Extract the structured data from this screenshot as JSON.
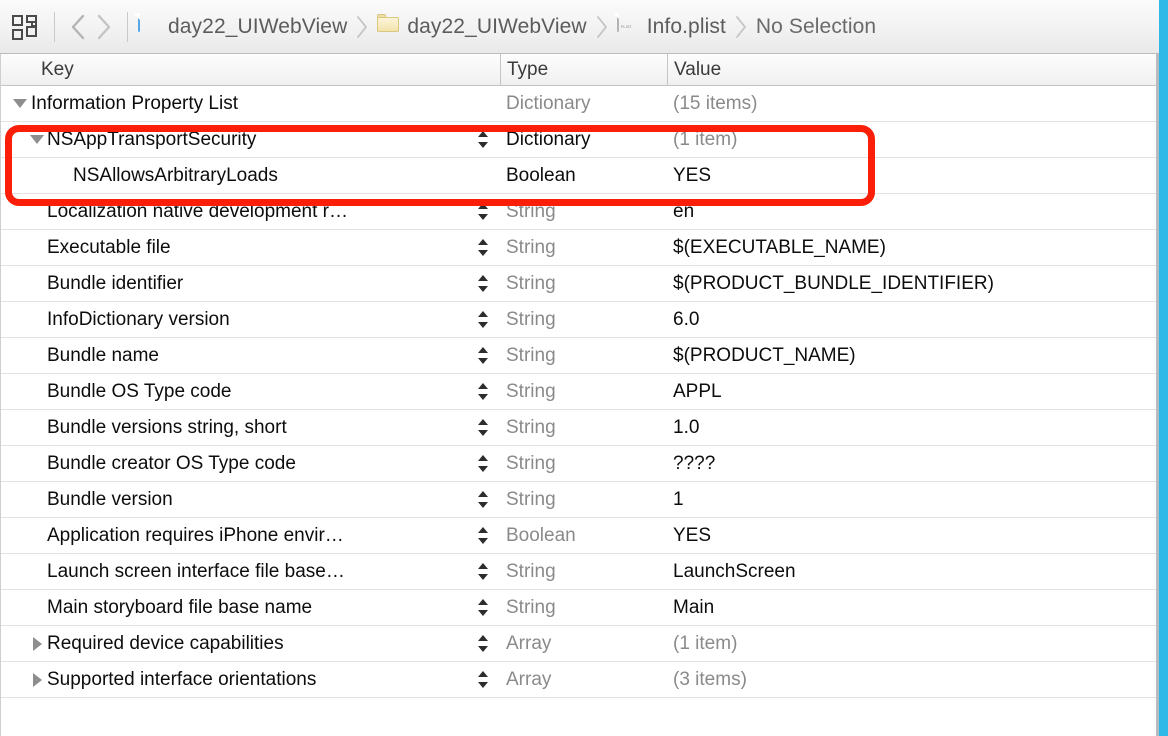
{
  "jumpbar": {
    "grid_icon": "grid-icon",
    "back_label": "Back",
    "forward_label": "Forward",
    "breadcrumbs": [
      {
        "label": "day22_UIWebView",
        "icon": "xcodeproj-icon"
      },
      {
        "label": "day22_UIWebView",
        "icon": "folder-icon"
      },
      {
        "label": "Info.plist",
        "icon": "plist-file-icon"
      },
      {
        "label": "No Selection",
        "icon": "none"
      }
    ]
  },
  "table": {
    "columns": {
      "key": "Key",
      "type": "Type",
      "value": "Value"
    },
    "rows": [
      {
        "key": "Information Property List",
        "type": "Dictionary",
        "value": "(15 items)",
        "indent": 0,
        "disclosure": "down",
        "stepper": false,
        "type_muted": true,
        "value_muted": true
      },
      {
        "key": "NSAppTransportSecurity",
        "type": "Dictionary",
        "value": "(1 item)",
        "indent": 1,
        "disclosure": "down",
        "stepper": true,
        "type_muted": false,
        "value_muted": true
      },
      {
        "key": "NSAllowsArbitraryLoads",
        "type": "Boolean",
        "value": "YES",
        "indent": 2,
        "disclosure": "none",
        "stepper": false,
        "type_muted": false,
        "value_muted": false
      },
      {
        "key": "Localization native development r…",
        "type": "String",
        "value": "en",
        "indent": 1,
        "disclosure": "none",
        "stepper": true,
        "type_muted": true,
        "value_muted": false
      },
      {
        "key": "Executable file",
        "type": "String",
        "value": "$(EXECUTABLE_NAME)",
        "indent": 1,
        "disclosure": "none",
        "stepper": true,
        "type_muted": true,
        "value_muted": false
      },
      {
        "key": "Bundle identifier",
        "type": "String",
        "value": "$(PRODUCT_BUNDLE_IDENTIFIER)",
        "indent": 1,
        "disclosure": "none",
        "stepper": true,
        "type_muted": true,
        "value_muted": false
      },
      {
        "key": "InfoDictionary version",
        "type": "String",
        "value": "6.0",
        "indent": 1,
        "disclosure": "none",
        "stepper": true,
        "type_muted": true,
        "value_muted": false
      },
      {
        "key": "Bundle name",
        "type": "String",
        "value": "$(PRODUCT_NAME)",
        "indent": 1,
        "disclosure": "none",
        "stepper": true,
        "type_muted": true,
        "value_muted": false
      },
      {
        "key": "Bundle OS Type code",
        "type": "String",
        "value": "APPL",
        "indent": 1,
        "disclosure": "none",
        "stepper": true,
        "type_muted": true,
        "value_muted": false
      },
      {
        "key": "Bundle versions string, short",
        "type": "String",
        "value": "1.0",
        "indent": 1,
        "disclosure": "none",
        "stepper": true,
        "type_muted": true,
        "value_muted": false
      },
      {
        "key": "Bundle creator OS Type code",
        "type": "String",
        "value": "????",
        "indent": 1,
        "disclosure": "none",
        "stepper": true,
        "type_muted": true,
        "value_muted": false
      },
      {
        "key": "Bundle version",
        "type": "String",
        "value": "1",
        "indent": 1,
        "disclosure": "none",
        "stepper": true,
        "type_muted": true,
        "value_muted": false
      },
      {
        "key": "Application requires iPhone envir…",
        "type": "Boolean",
        "value": "YES",
        "indent": 1,
        "disclosure": "none",
        "stepper": true,
        "type_muted": true,
        "value_muted": false
      },
      {
        "key": "Launch screen interface file base…",
        "type": "String",
        "value": "LaunchScreen",
        "indent": 1,
        "disclosure": "none",
        "stepper": true,
        "type_muted": true,
        "value_muted": false
      },
      {
        "key": "Main storyboard file base name",
        "type": "String",
        "value": "Main",
        "indent": 1,
        "disclosure": "none",
        "stepper": true,
        "type_muted": true,
        "value_muted": false
      },
      {
        "key": "Required device capabilities",
        "type": "Array",
        "value": "(1 item)",
        "indent": 1,
        "disclosure": "right",
        "stepper": true,
        "type_muted": true,
        "value_muted": true
      },
      {
        "key": "Supported interface orientations",
        "type": "Array",
        "value": "(3 items)",
        "indent": 1,
        "disclosure": "right",
        "stepper": true,
        "type_muted": true,
        "value_muted": true
      }
    ]
  },
  "annotation": {
    "highlight_color": "#fb1e08",
    "highlight_target": "NSAppTransportSecurity / NSAllowsArbitraryLoads"
  },
  "colors": {
    "edge_strip": "#2fb9e8",
    "muted_text": "#8a8a8a",
    "key_text": "#0d0d0d"
  }
}
